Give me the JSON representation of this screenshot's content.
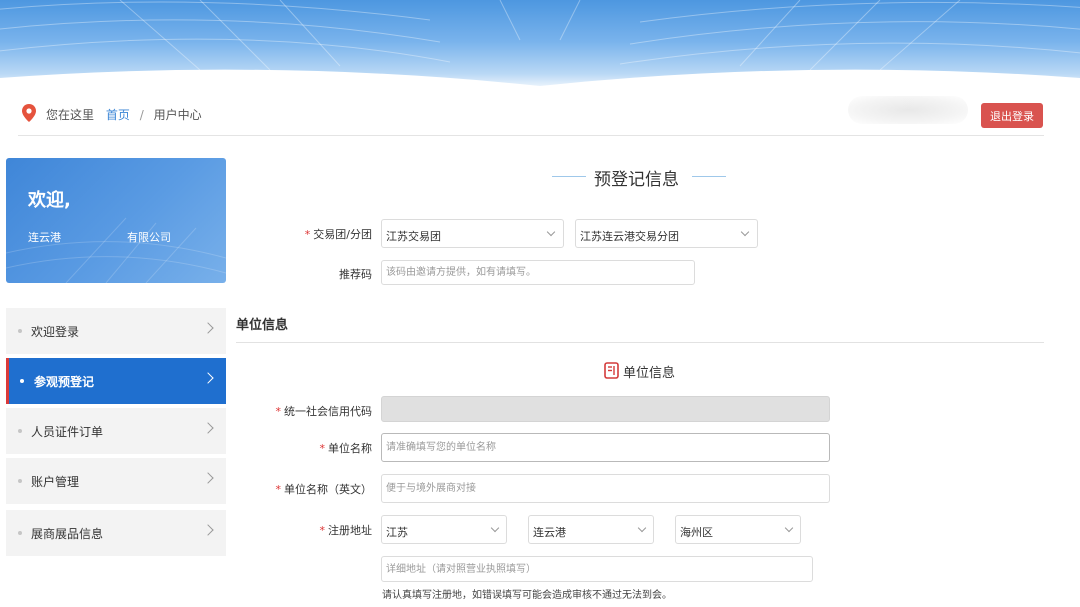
{
  "breadcrumb": {
    "prefix": "您在这里",
    "home": "首页",
    "separator": "/",
    "current": "用户中心"
  },
  "header": {
    "logout_label": "退出登录"
  },
  "welcome": {
    "title": "欢迎,",
    "company_prefix": "连云港",
    "company_suffix": "有限公司"
  },
  "sidebar": {
    "items": [
      {
        "label": "欢迎登录",
        "active": false
      },
      {
        "label": "参观预登记",
        "active": true
      },
      {
        "label": "人员证件订单",
        "active": false
      },
      {
        "label": "账户管理",
        "active": false
      },
      {
        "label": "展商展品信息",
        "active": false
      }
    ]
  },
  "form": {
    "title": "预登记信息",
    "group": {
      "label": "交易团/分团",
      "required": "*",
      "group_value": "江苏交易团",
      "subgroup_value": "江苏连云港交易分团"
    },
    "referral": {
      "label": "推荐码",
      "placeholder": "该码由邀请方提供，如有请填写。"
    },
    "unit_section_title": "单位信息",
    "unit_subheading": "单位信息",
    "credit_code": {
      "label": "统一社会信用代码",
      "required": "*"
    },
    "unit_name": {
      "label": "单位名称",
      "required": "*",
      "placeholder": "请准确填写您的单位名称"
    },
    "unit_name_en": {
      "label": "单位名称（英文）",
      "required": "*",
      "placeholder": "便于与境外展商对接"
    },
    "address": {
      "label": "注册地址",
      "required": "*",
      "province": "江苏",
      "city": "连云港",
      "district": "海州区",
      "detail_placeholder": "详细地址（请对照营业执照填写）",
      "hint": "请认真填写注册地，如错误填写可能会造成审核不通过无法到会。"
    }
  },
  "colors": {
    "primary_blue": "#1f6fcf",
    "logout_red": "#d9534f",
    "active_marker": "#d93a3a",
    "link_blue": "#3b86d6"
  }
}
